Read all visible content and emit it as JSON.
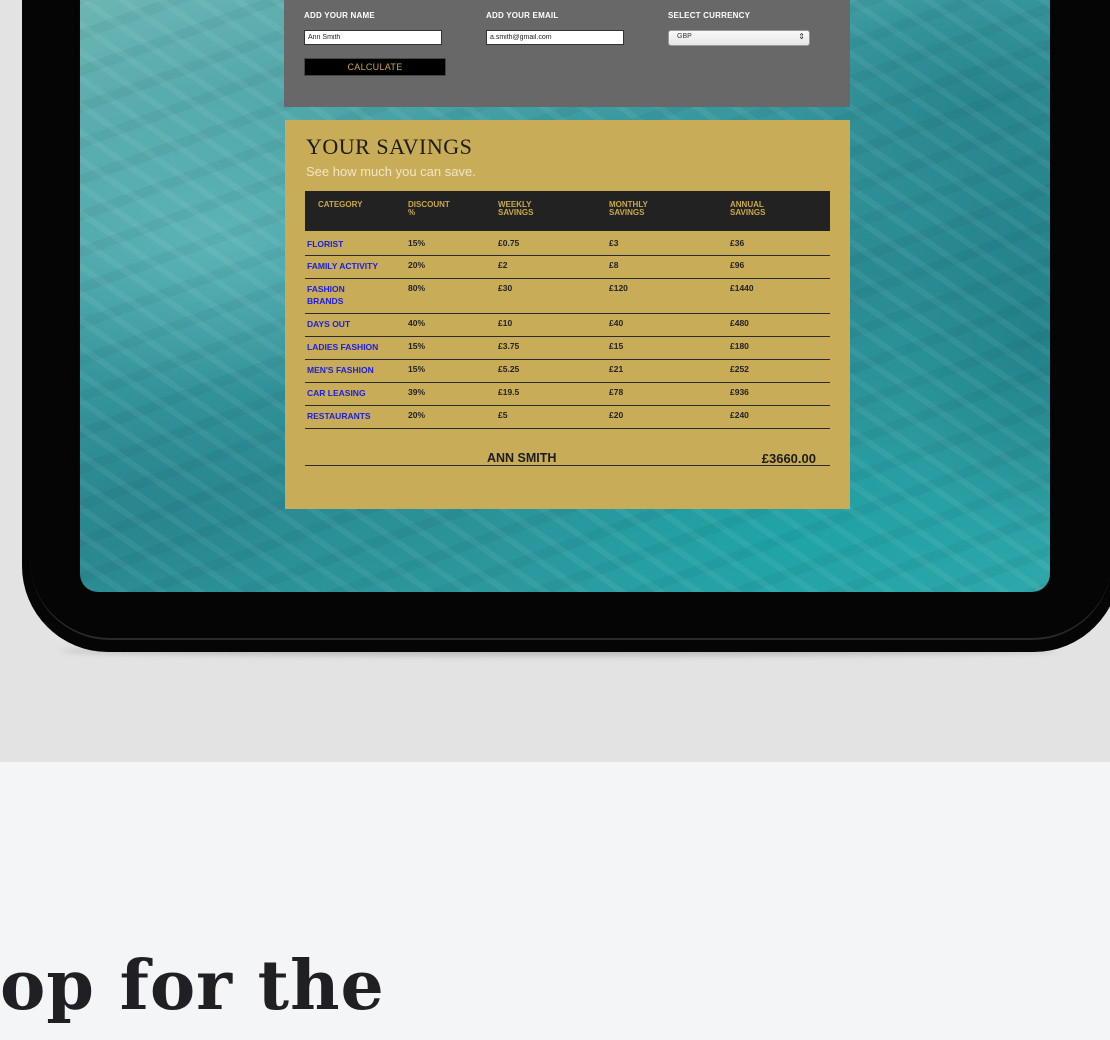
{
  "form": {
    "name_label": "ADD YOUR NAME",
    "name_value": "Ann Smith",
    "email_label": "ADD YOUR EMAIL",
    "email_value": "a.smith@gmail.com",
    "currency_label": "SELECT CURRENCY",
    "currency_value": "GBP",
    "calculate_label": "CALCULATE"
  },
  "savings": {
    "title": "YOUR SAVINGS",
    "subtitle": "See how much you can save.",
    "headers": [
      "CATEGORY",
      "DISCOUNT %",
      "WEEKLY SAVINGS",
      "MONTHLY SAVINGS",
      "ANNUAL SAVINGS"
    ],
    "rows": [
      [
        "FLORIST",
        "15%",
        "£0.75",
        "£3",
        "£36"
      ],
      [
        "FAMILY ACTIVITY",
        "20%",
        "£2",
        "£8",
        "£96"
      ],
      [
        "FASHION BRANDS",
        "80%",
        "£30",
        "£120",
        "£1440"
      ],
      [
        "DAYS OUT",
        "40%",
        "£10",
        "£40",
        "£480"
      ],
      [
        "LADIES FASHION",
        "15%",
        "£3.75",
        "£15",
        "£180"
      ],
      [
        "MEN'S FASHION",
        "15%",
        "£5.25",
        "£21",
        "£252"
      ],
      [
        "CAR LEASING",
        "39%",
        "£19.5",
        "£78",
        "£936"
      ],
      [
        "RESTAURANTS",
        "20%",
        "£5",
        "£20",
        "£240"
      ]
    ],
    "total_name": "ANN SMITH",
    "total_value": "£3660.00"
  },
  "page": {
    "headline": "op for the"
  },
  "colors": {
    "gold": "#c8ac58",
    "panel_gray": "#686868",
    "category_blue": "#1a1ee0",
    "page_bg": "#f4f5f7"
  }
}
